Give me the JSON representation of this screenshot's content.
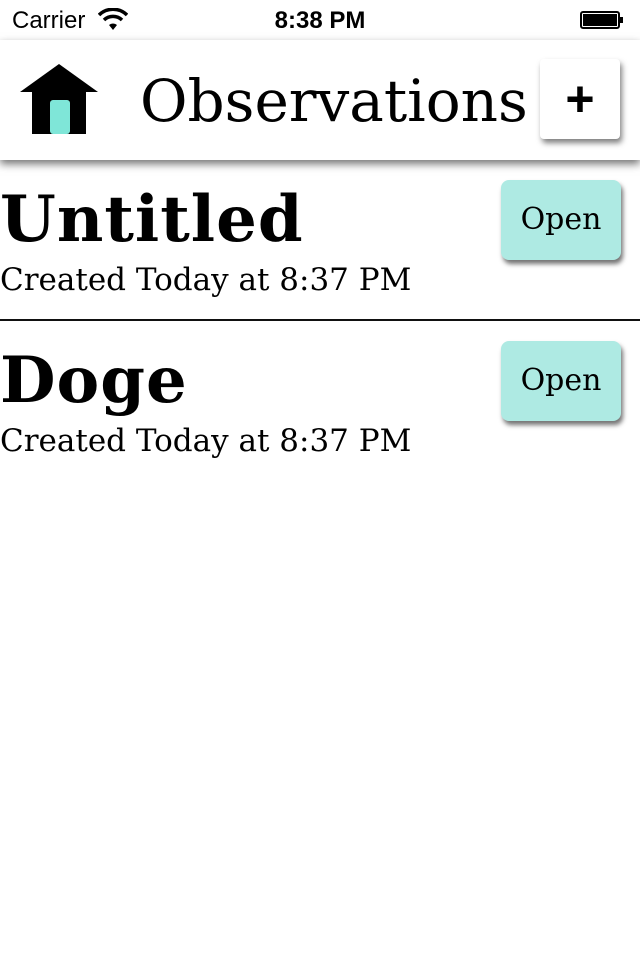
{
  "status_bar": {
    "carrier": "Carrier",
    "time": "8:38 PM",
    "wifi_icon": "wifi-icon",
    "battery_icon": "battery-icon"
  },
  "nav": {
    "title": "Observations",
    "add_label": "+",
    "home_icon": "home-icon"
  },
  "observations": [
    {
      "title": "Untitled",
      "created": "Created Today at 8:37 PM",
      "open_label": "Open"
    },
    {
      "title": "Doge",
      "created": "Created Today at 8:37 PM",
      "open_label": "Open"
    }
  ],
  "colors": {
    "open_button_bg": "#aeeae3",
    "home_door": "#7fe6d8"
  }
}
